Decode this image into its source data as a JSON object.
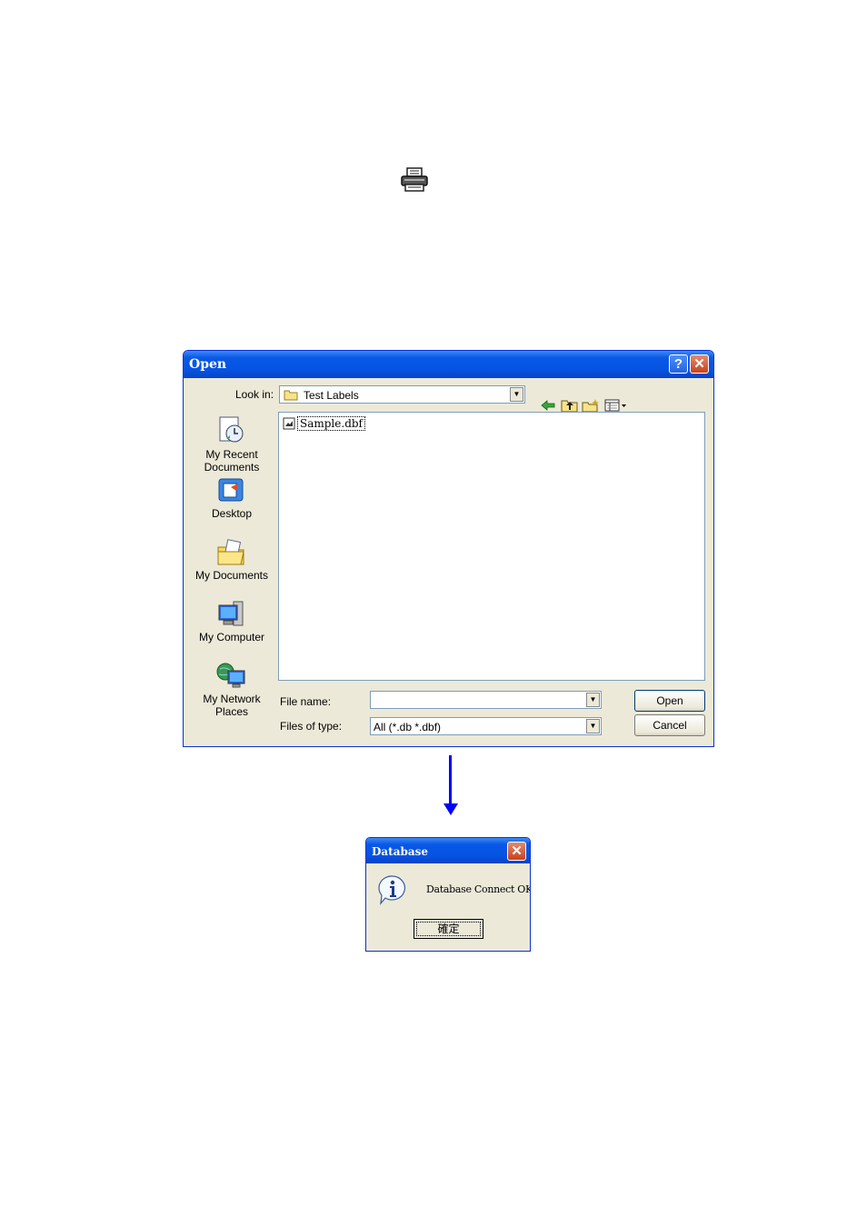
{
  "open_dialog": {
    "title": "Open",
    "help_glyph": "?",
    "close_glyph": "✕",
    "look_in_label": "Look in:",
    "look_in_value": "Test Labels",
    "toolbar_icons": [
      "back-arrow-icon",
      "up-folder-icon",
      "new-folder-icon",
      "view-menu-icon"
    ],
    "places": [
      {
        "label1": "My Recent",
        "label2": "Documents"
      },
      {
        "label1": "Desktop",
        "label2": ""
      },
      {
        "label1": "My Documents",
        "label2": ""
      },
      {
        "label1": "My Computer",
        "label2": ""
      },
      {
        "label1": "My Network",
        "label2": "Places"
      }
    ],
    "files": [
      "Sample.dbf"
    ],
    "file_name_label": "File name:",
    "file_name_value": "",
    "file_type_label": "Files of type:",
    "file_type_value": "All (*.db *.dbf)",
    "open_button": "Open",
    "cancel_button": "Cancel"
  },
  "db_dialog": {
    "title": "Database",
    "message": "Database Connect OK",
    "ok_button": "確定",
    "close_glyph": "✕"
  }
}
